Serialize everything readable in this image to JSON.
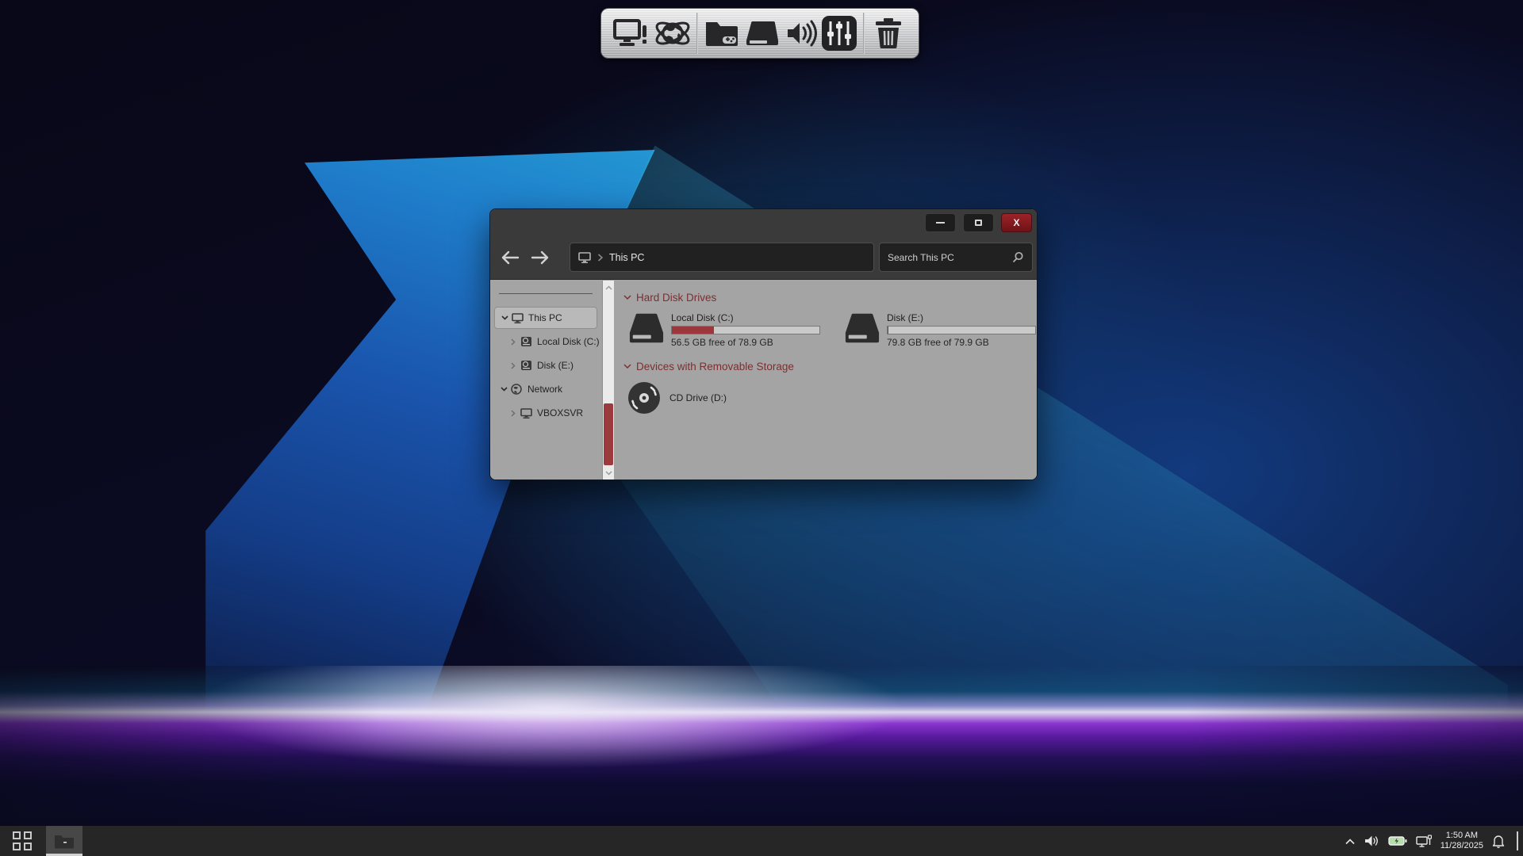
{
  "dock": {
    "icons": [
      "my-computer",
      "internet-globe",
      "games-folder",
      "hard-drive",
      "volume",
      "mixer",
      "recycle-bin"
    ]
  },
  "window": {
    "controls": {
      "close_glyph": "X"
    },
    "navigation": {
      "address_location": "This PC",
      "search_placeholder": "Search This PC"
    },
    "sidebar": {
      "items": [
        {
          "label": "This PC",
          "icon": "computer",
          "state": "expanded",
          "selected": true
        },
        {
          "label": "Local Disk (C:)",
          "icon": "drive",
          "state": "collapsed",
          "selected": false
        },
        {
          "label": "Disk (E:)",
          "icon": "drive",
          "state": "collapsed",
          "selected": false
        },
        {
          "label": "Network",
          "icon": "network-globe",
          "state": "expanded",
          "selected": false
        },
        {
          "label": "VBOXSVR",
          "icon": "computer",
          "state": "collapsed",
          "selected": false
        }
      ]
    },
    "content": {
      "sections": [
        {
          "title": "Hard Disk Drives"
        },
        {
          "title": "Devices with Removable Storage"
        }
      ],
      "drives": [
        {
          "name": "Local Disk (C:)",
          "free_text": "56.5 GB free of 78.9 GB",
          "used_percent": 28.4
        },
        {
          "name": "Disk (E:)",
          "free_text": "79.8 GB free of 79.9 GB",
          "used_percent": 0.5
        }
      ],
      "removable": [
        {
          "name": "CD Drive (D:)"
        }
      ]
    }
  },
  "taskbar": {
    "clock": {
      "time": "1:50 AM",
      "date": "11/28/2025"
    },
    "tray_icons": [
      "hidden-icons-chevron",
      "volume",
      "battery-charging",
      "network",
      "notifications-bell"
    ]
  },
  "colors": {
    "accent_red": "#9c383c",
    "section_title": "#7d2e31",
    "scroll_thumb": "#9c3a3e",
    "close_button": "#8c1f24",
    "battery_green": "#b7dcae",
    "chrome_dark": "#3a3a3a",
    "content_gray": "#a4a4a4",
    "taskbar_dark": "#262626"
  }
}
